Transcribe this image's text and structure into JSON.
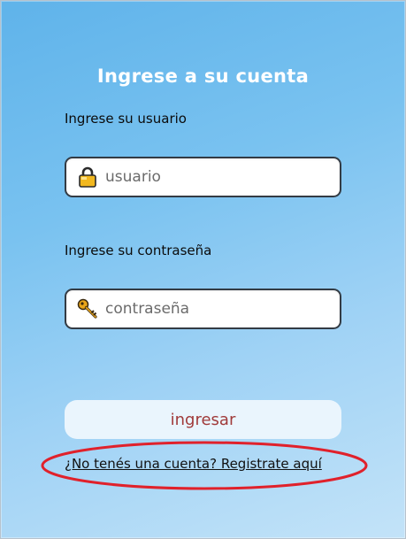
{
  "form": {
    "title": "Ingrese a su cuenta",
    "username_label": "Ingrese su usuario",
    "username_placeholder": "usuario",
    "password_label": "Ingrese su contraseña",
    "password_placeholder": "contraseña",
    "submit_label": "ingresar",
    "register_link": "¿No tenés una cuenta? Registrate aquí"
  },
  "icons": {
    "username": "lock-icon",
    "password": "key-icon"
  },
  "colors": {
    "highlight": "#e0212b",
    "submit_text": "#a03a3a",
    "title_text": "#ffffff"
  }
}
